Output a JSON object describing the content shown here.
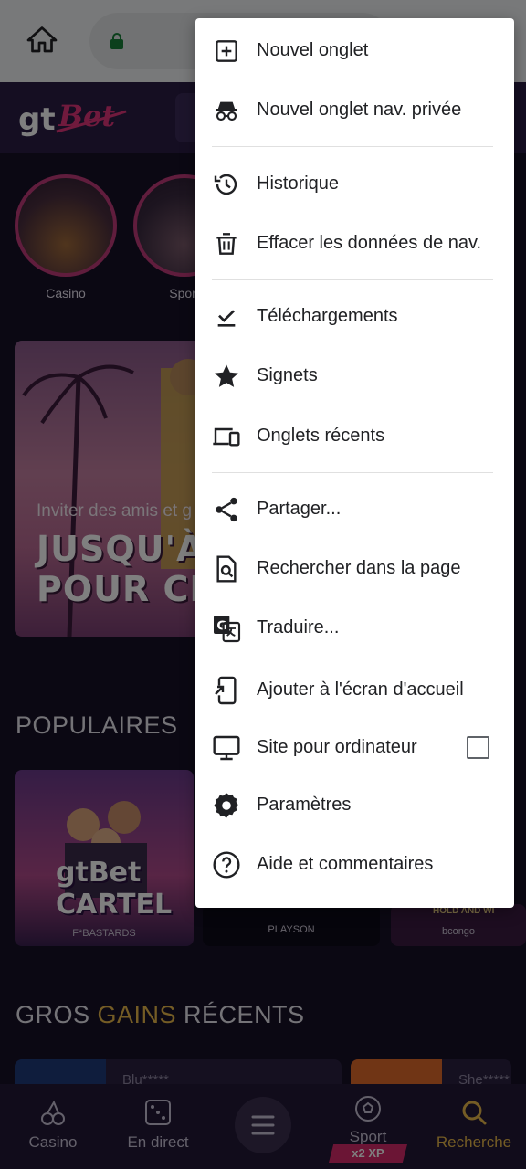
{
  "browser": {
    "home_icon": "home-icon",
    "lock_icon": "lock-icon",
    "lock_color": "#188038"
  },
  "page": {
    "categories": [
      {
        "label": "Casino"
      },
      {
        "label": "Sport"
      }
    ],
    "hero": {
      "subtitle": "Inviter des amis et g",
      "line1": "JUSQU'À",
      "line2": "POUR CHA"
    },
    "popular_title": "POPULAIRES",
    "games": [
      {
        "provider": "F*BASTARDS",
        "title": "gtBet CARTEL"
      },
      {
        "provider": "PLAYSON"
      },
      {
        "provider": "bcongo",
        "badge": "HOLD AND WI"
      }
    ],
    "wins_title_part1": "GROS ",
    "wins_title_accent": "GAINS",
    "wins_title_part2": " RÉCENTS",
    "wins": [
      {
        "user": "Blu*****"
      },
      {
        "user": "She*****"
      }
    ],
    "accent_color": "#e8b84a"
  },
  "bottom_nav": {
    "items": [
      {
        "label": "Casino",
        "icon": "cherries-icon"
      },
      {
        "label": "En direct",
        "icon": "dice-icon"
      },
      {
        "label": "",
        "icon": "hamburger-menu-icon"
      },
      {
        "label": "Sport",
        "icon": "soccer-ball-icon",
        "badge": "x2 XP"
      },
      {
        "label": "Recherche",
        "icon": "search-icon"
      }
    ],
    "active_color": "#e8b84a"
  },
  "menu": {
    "items": [
      {
        "label": "Nouvel onglet",
        "icon": "new-tab-icon"
      },
      {
        "label": "Nouvel onglet nav. privée",
        "icon": "incognito-icon"
      },
      {
        "label": "Historique",
        "icon": "history-icon"
      },
      {
        "label": "Effacer les données de nav.",
        "icon": "trash-icon"
      },
      {
        "label": "Téléchargements",
        "icon": "download-icon"
      },
      {
        "label": "Signets",
        "icon": "star-icon"
      },
      {
        "label": "Onglets récents",
        "icon": "devices-icon"
      },
      {
        "label": "Partager...",
        "icon": "share-icon"
      },
      {
        "label": "Rechercher dans la page",
        "icon": "find-in-page-icon"
      },
      {
        "label": "Traduire...",
        "icon": "translate-icon"
      },
      {
        "label": "Ajouter à l'écran d'accueil",
        "icon": "add-to-home-icon"
      },
      {
        "label": "Site pour ordinateur",
        "icon": "desktop-icon",
        "checked": false
      },
      {
        "label": "Paramètres",
        "icon": "settings-icon"
      },
      {
        "label": "Aide et commentaires",
        "icon": "help-icon"
      }
    ]
  }
}
